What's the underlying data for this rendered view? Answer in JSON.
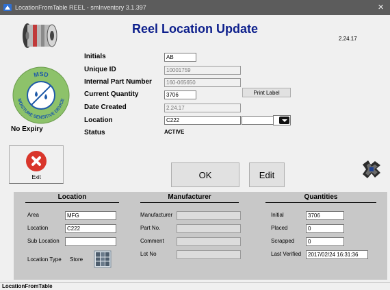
{
  "window": {
    "title": "LocationFromTable REEL - smInventory 3.1.397",
    "close_glyph": "×"
  },
  "header": {
    "heading": "Reel Location Update",
    "version": "2.24.17"
  },
  "logo": {
    "text_top": "MSD",
    "text_bottom": "MOISTURE SENSITIVE DEVICE",
    "color": "#8dc26a"
  },
  "expiry": "No Expiry",
  "form": {
    "initials_label": "Initials",
    "initials_value": "AB",
    "unique_id_label": "Unique ID",
    "unique_id_value": "10001759",
    "ipn_label": "Internal Part Number",
    "ipn_value": "160-065650",
    "qty_label": "Current Quantity",
    "qty_value": "3706",
    "created_label": "Date Created",
    "created_value": "2.24.17",
    "location_label": "Location",
    "location_value": "C222",
    "location_dropdown_value": "",
    "status_label": "Status",
    "status_value": "ACTIVE",
    "print_label": "Print Label"
  },
  "buttons": {
    "exit": "Exit",
    "ok": "OK",
    "edit": "Edit"
  },
  "location_section": {
    "title": "Location",
    "area_label": "Area",
    "area_value": "MFG",
    "location_label": "Location",
    "location_value": "C222",
    "sub_location_label": "Sub Location",
    "sub_location_value": "",
    "type_label": "Location Type",
    "type_value": "Store"
  },
  "manufacturer_section": {
    "title": "Manufacturer",
    "manufacturer_label": "Manufacturer",
    "manufacturer_value": "",
    "part_no_label": "Part No.",
    "part_no_value": "",
    "comment_label": "Comment",
    "comment_value": "",
    "lot_no_label": "Lot No",
    "lot_no_value": ""
  },
  "quantities_section": {
    "title": "Quantities",
    "initial_label": "Initial",
    "initial_value": "3706",
    "placed_label": "Placed",
    "placed_value": "0",
    "scrapped_label": "Scrapped",
    "scrapped_value": "0",
    "last_verified_label": "Last Verified",
    "last_verified_value": "2017/02/24 16:31:36"
  },
  "statusbar": {
    "text": "LocationFromTable"
  },
  "colors": {
    "heading": "#0d1f8c",
    "exit_red": "#d9362b",
    "titlebar": "#5c5c5c",
    "panel": "#c8c8c8"
  }
}
